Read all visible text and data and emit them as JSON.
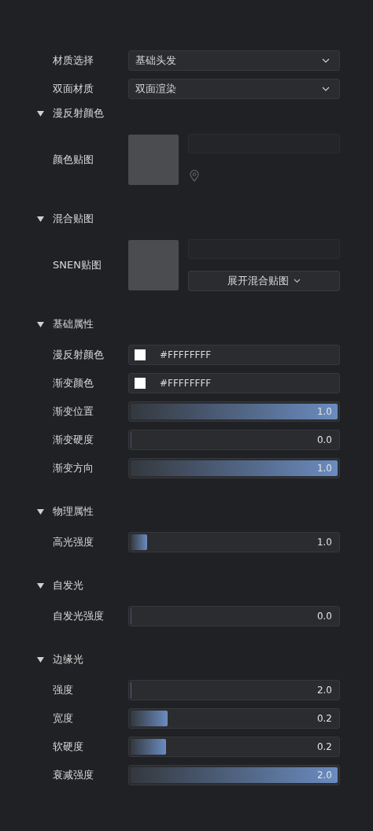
{
  "selects": [
    {
      "label": "材质选择",
      "value": "基础头发"
    },
    {
      "label": "双面材质",
      "value": "双面渲染"
    }
  ],
  "sections": [
    {
      "title": "漫反射颜色",
      "expanded": true,
      "rows": [
        {
          "kind": "texture",
          "label": "颜色贴图",
          "pin": true
        }
      ]
    },
    {
      "title": "混合贴图",
      "expanded": true,
      "rows": [
        {
          "kind": "texture",
          "label": "SNEN贴图",
          "button": "展开混合贴图"
        }
      ]
    },
    {
      "title": "基础属性",
      "expanded": true,
      "rows": [
        {
          "kind": "color",
          "label": "漫反射颜色",
          "color": "#ffffff",
          "value": "#FFFFFFFF"
        },
        {
          "kind": "color",
          "label": "渐变颜色",
          "color": "#ffffff",
          "value": "#FFFFFFFF"
        },
        {
          "kind": "slider",
          "label": "渐变位置",
          "level": 1,
          "value": "1.0"
        },
        {
          "kind": "slider",
          "label": "渐变硬度",
          "level": 0,
          "value": "0.0"
        },
        {
          "kind": "slider",
          "label": "渐变方向",
          "level": 1,
          "value": "1.0"
        }
      ]
    },
    {
      "title": "物理属性",
      "expanded": true,
      "rows": [
        {
          "kind": "slider",
          "label": "高光强度",
          "level": 0.08,
          "value": "1.0"
        }
      ]
    },
    {
      "title": "自发光",
      "expanded": true,
      "rows": [
        {
          "kind": "slider",
          "label": "自发光强度",
          "level": 0,
          "value": "0.0"
        }
      ]
    },
    {
      "title": "边缘光",
      "expanded": true,
      "rows": [
        {
          "kind": "slider",
          "label": "强度",
          "level": 0.004,
          "value": "2.0"
        },
        {
          "kind": "slider",
          "label": "宽度",
          "level": 0.18,
          "value": "0.2"
        },
        {
          "kind": "slider",
          "label": "软硬度",
          "level": 0.17,
          "value": "0.2"
        },
        {
          "kind": "slider",
          "label": "衰减强度",
          "level": 1,
          "value": "2.0"
        }
      ]
    }
  ]
}
